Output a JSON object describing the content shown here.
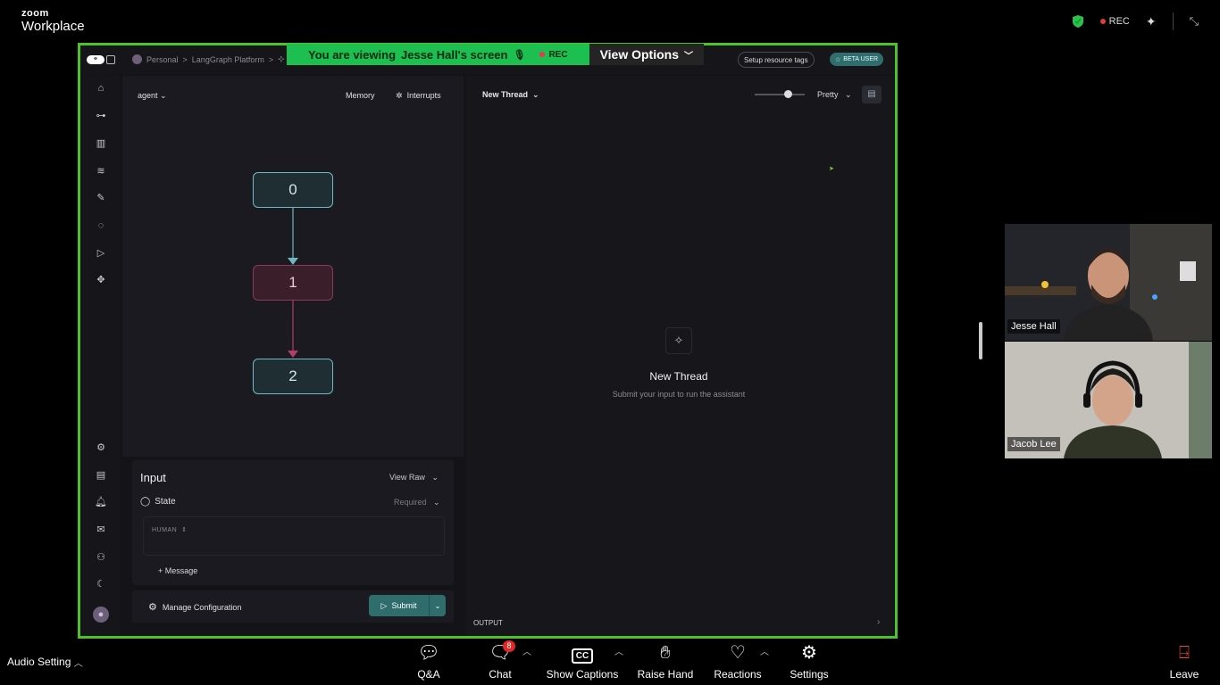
{
  "zoom": {
    "logo_line1": "zoom",
    "logo_line2": "Workplace",
    "rec_label": "REC",
    "banner_text": "You are viewing",
    "banner_name": "Jesse Hall's screen",
    "banner_rec": "REC",
    "view_options": "View Options"
  },
  "langgraph": {
    "breadcrumbs": [
      "Personal",
      ">",
      "LangGraph Platform",
      ">"
    ],
    "setup_tags": "Setup resource tags",
    "beta": "BETA USER",
    "agent_select": "agent",
    "memory": "Memory",
    "interrupts": "Interrupts",
    "nodes": [
      "0",
      "1",
      "2"
    ],
    "input_title": "Input",
    "view_raw": "View Raw",
    "state_label": "State",
    "required": "Required",
    "human_label": "HUMAN",
    "add_message": "+ Message",
    "manage_config": "Manage Configuration",
    "submit": "Submit",
    "thread_select": "New Thread",
    "pretty": "Pretty",
    "empty_title": "New Thread",
    "empty_subtitle": "Submit your input to run the assistant",
    "output_label": "OUTPUT"
  },
  "participants": [
    {
      "name": "Jesse Hall"
    },
    {
      "name": "Jacob Lee"
    }
  ],
  "toolbar": {
    "audio": "Audio Setting",
    "qa": "Q&A",
    "chat": "Chat",
    "chat_badge": "8",
    "captions": "Show Captions",
    "raise_hand": "Raise Hand",
    "reactions": "Reactions",
    "settings": "Settings",
    "leave": "Leave"
  },
  "colors": {
    "share_border": "#4cc429",
    "banner_green": "#1dbf50",
    "node_teal": "#6fb9c4",
    "node_pink": "#8a3b57",
    "submit_bg": "#2f6d6c"
  }
}
